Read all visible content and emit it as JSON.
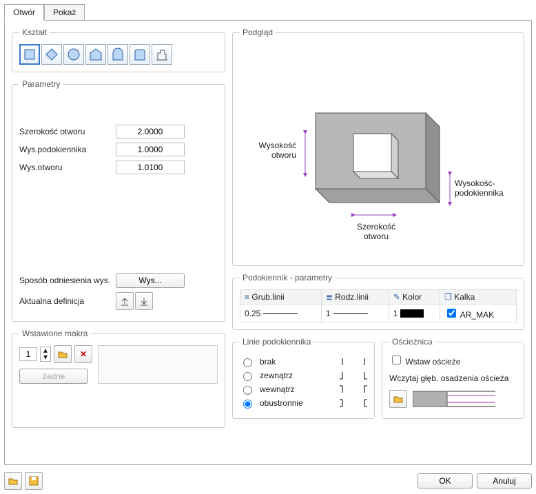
{
  "tabs": {
    "active": "Otwór",
    "other": "Pokaż"
  },
  "shape": {
    "legend": "Kształt"
  },
  "params": {
    "legend": "Parametry",
    "width_label": "Szerokość otworu",
    "width_val": "2.0000",
    "sill_label": "Wys.podokiennika",
    "sill_val": "1.0000",
    "height_label": "Wys.otworu",
    "height_val": "1.0100",
    "ref_label": "Sposób odniesienia wys.",
    "ref_btn": "Wys...",
    "def_label": "Aktualna   definicja"
  },
  "preview": {
    "legend": "Podgląd",
    "h_label": "Wysokość otworu",
    "w_label": "Szerokość otworu",
    "sill_label": "Wysokość-podokiennika"
  },
  "sill_params": {
    "legend": "Podokiennik - parametry",
    "col1": "Grub.linii",
    "col2": "Rodz.linii",
    "col3": "Kolor",
    "col4": "Kalka",
    "v1": "0.25",
    "v2": "1",
    "v3": "1",
    "v4": "AR_MAK"
  },
  "macros": {
    "legend": "Wstawione makra",
    "count": "1",
    "none_btn": "żadne"
  },
  "sill_lines": {
    "legend": "Linie podokiennika",
    "o1": "brak",
    "o2": "zewnątrz",
    "o3": "wewnątrz",
    "o4": "obustronnie"
  },
  "frame": {
    "legend": "Ościeżnica",
    "chk": "Wstaw ościeże",
    "depth": "Wczytaj głęb. osadzenia ościeża"
  },
  "buttons": {
    "ok": "OK",
    "cancel": "Anuluj"
  }
}
